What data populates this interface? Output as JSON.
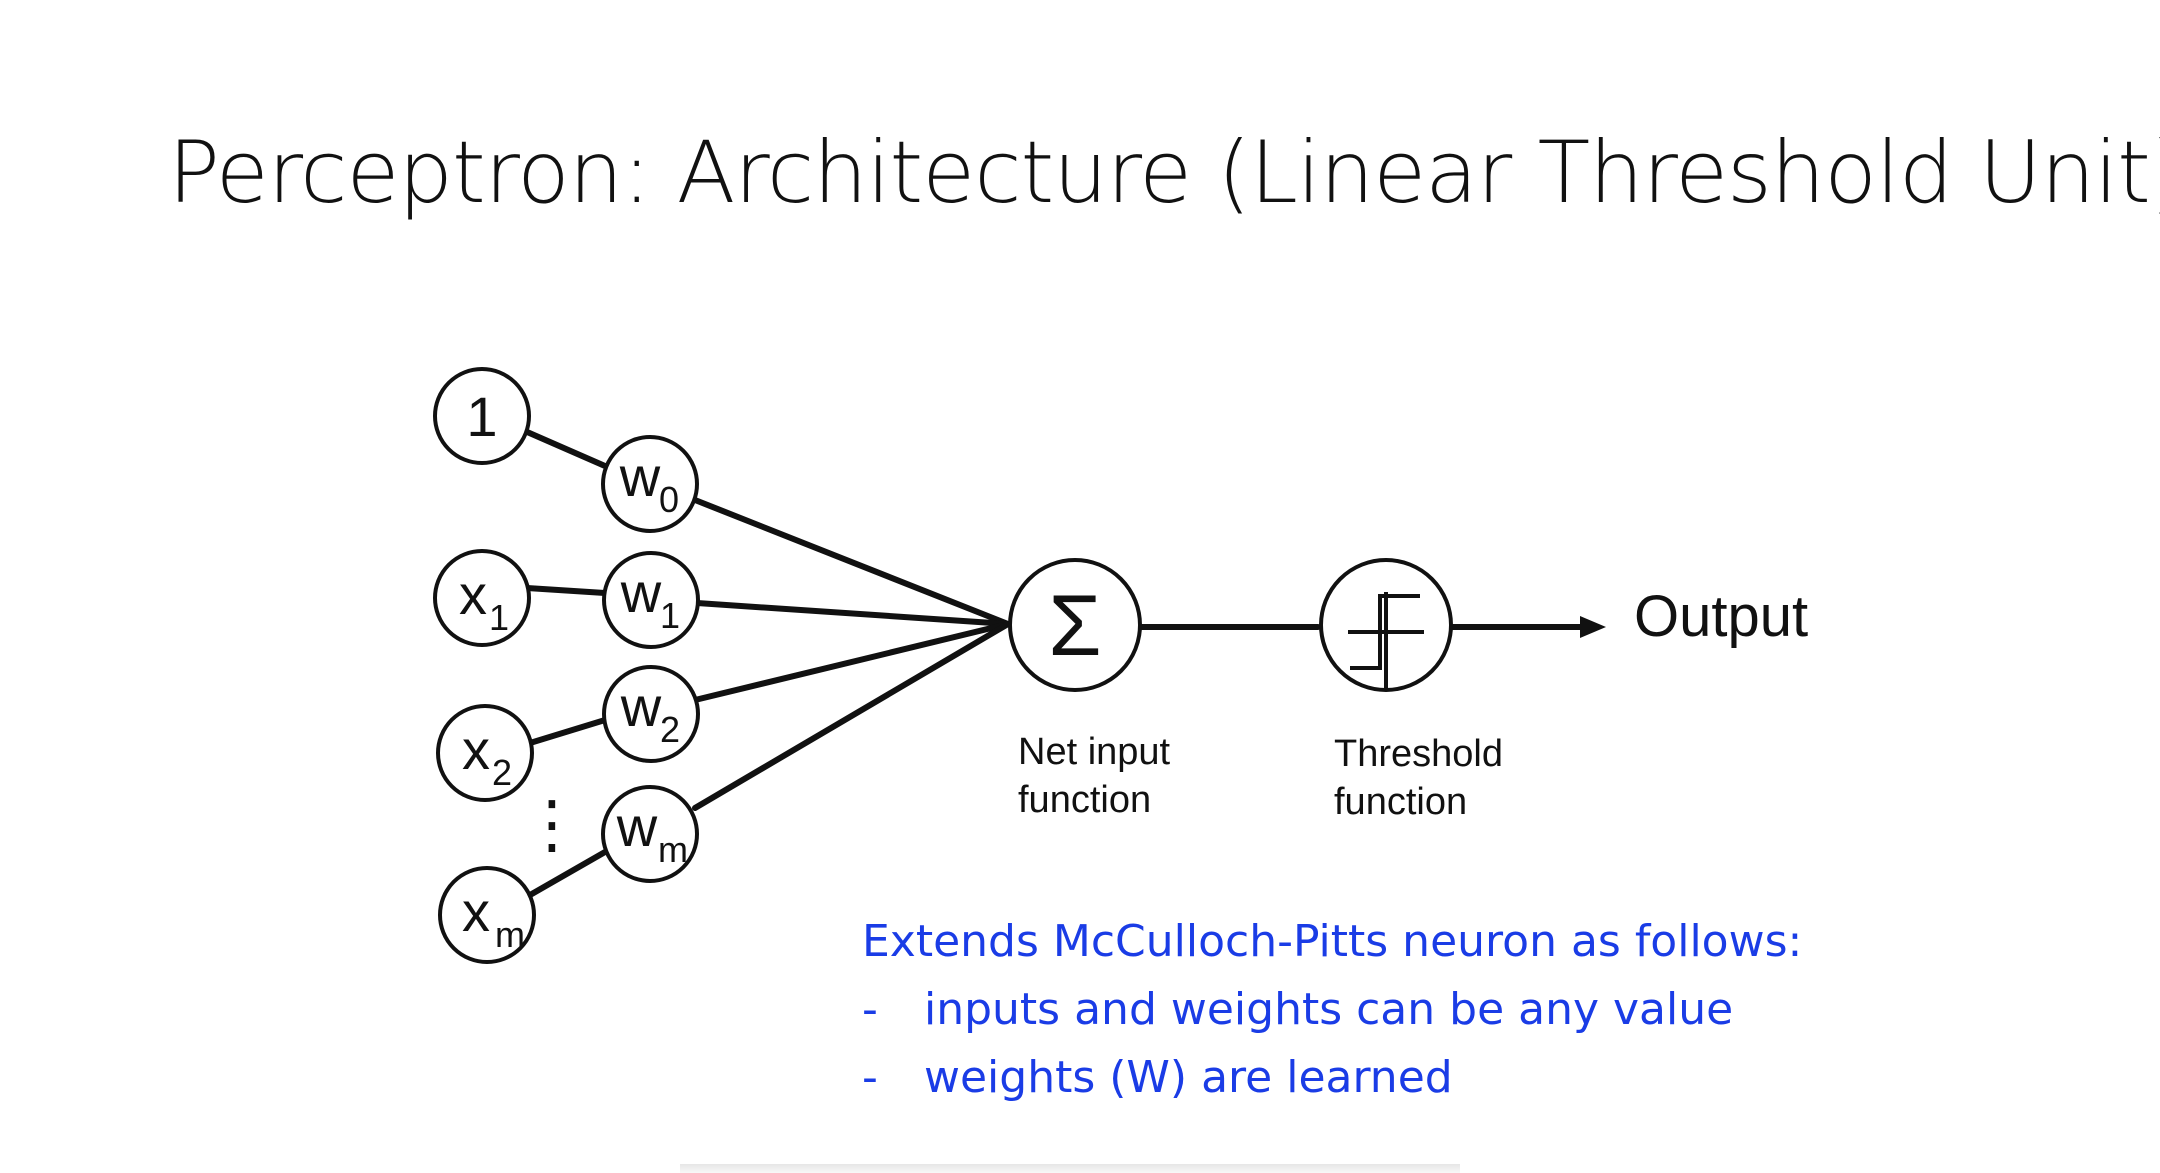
{
  "slide": {
    "title": "Perceptron: Architecture (Linear Threshold Unit)",
    "notes": {
      "heading": "Extends McCulloch-Pitts neuron as follows:",
      "bullets": [
        {
          "dash": "-",
          "text": "inputs and weights can be any value"
        },
        {
          "dash": "-",
          "text": "weights (W) are learned"
        }
      ]
    }
  },
  "diagram": {
    "inputs": [
      {
        "main": "1",
        "sub": ""
      },
      {
        "main": "x",
        "sub": "1"
      },
      {
        "main": "x",
        "sub": "2"
      },
      {
        "main": "x",
        "sub": "m"
      }
    ],
    "weights": [
      {
        "main": "w",
        "sub": "0"
      },
      {
        "main": "w",
        "sub": "1"
      },
      {
        "main": "w",
        "sub": "2"
      },
      {
        "main": "w",
        "sub": "m"
      }
    ],
    "ellipsis": "⋮",
    "sum_symbol": "Σ",
    "net_input_label": [
      "Net input",
      "function"
    ],
    "threshold_label": [
      "Threshold",
      "function"
    ],
    "output_label": "Output"
  }
}
